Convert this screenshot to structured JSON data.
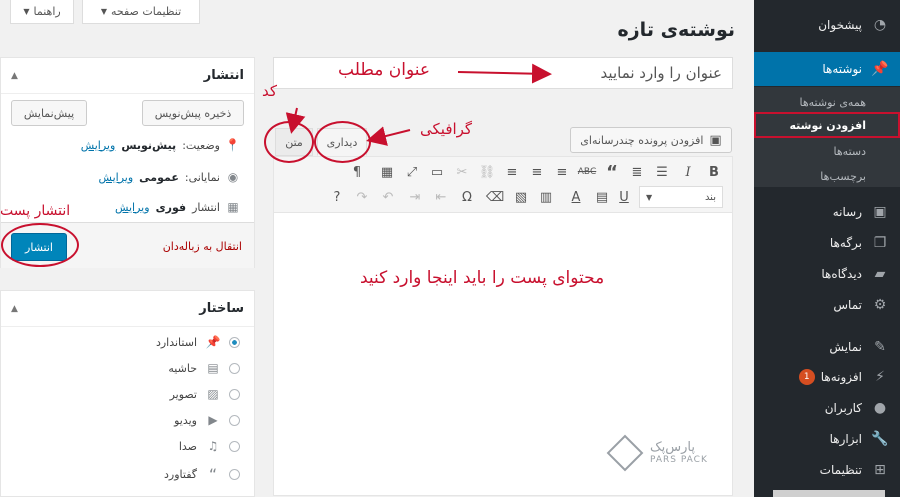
{
  "help_tabs": {
    "screen_options": "تنظیمات صفحه",
    "help": "راهنما"
  },
  "page_title": "نوشته‌ی تازه",
  "title_input": {
    "placeholder": "عنوان را وارد نمایید"
  },
  "editor": {
    "add_media": "افزودن پرونده چندرسانه‌ای",
    "tab_visual": "دیداری",
    "tab_text": "متن",
    "format_select": "بند",
    "toolbar_row1": [
      "B",
      "I",
      "bulleted-list",
      "numbered-list",
      "blockquote",
      "strikethrough",
      "align-right",
      "align-center",
      "align-left",
      "link",
      "unlink",
      "more-tag",
      "fullscreen",
      "toolbar-toggle",
      "pilcrow"
    ],
    "toolbar_row2": [
      "underline",
      "justify",
      "text-color",
      "paste-text",
      "paste-word",
      "clear-formatting",
      "special-char",
      "outdent",
      "indent",
      "undo",
      "redo",
      "help"
    ]
  },
  "publish_box": {
    "title": "انتشار",
    "save_draft": "ذخیره پیش‌نویس",
    "preview": "پیش‌نمایش",
    "status_label": "وضعیت:",
    "status_value": "پیش‌نویس",
    "visibility_label": "نمایانی:",
    "visibility_value": "عمومی",
    "schedule_label": "انتشار",
    "schedule_value": "فوری",
    "edit_link": "ویرایش",
    "trash": "انتقال به زباله‌دان",
    "publish": "انتشار"
  },
  "format_box": {
    "title": "ساختار",
    "options": [
      "استاندارد",
      "حاشیه",
      "تصویر",
      "ویدیو",
      "صدا",
      "گفتاورد"
    ],
    "selected": 0
  },
  "sidebar": {
    "dashboard": "پیشخوان",
    "posts": "نوشته‌ها",
    "submenu": [
      "همه‌ی نوشته‌ها",
      "افزودن نوشته",
      "دسته‌ها",
      "برچسب‌ها"
    ],
    "media": "رسانه",
    "pages": "برگه‌ها",
    "comments": "دیدگاه‌ها",
    "contact": "تماس",
    "appearance": "نمایش",
    "plugins": "افزونه‌ها",
    "plugins_badge": "1",
    "users": "کاربران",
    "tools": "ابزارها",
    "settings": "تنظیمات"
  },
  "annotations": {
    "post_title": "عنوان مطلب",
    "graphic": "گرافیکی",
    "code": "کد",
    "publish_post": "انتشار پست",
    "content_here": "محتوای پست را باید اینجا وارد کنید",
    "color": "#c8102e"
  },
  "watermark": {
    "name": "پارس‌پک",
    "latin": "PARS PACK"
  },
  "colors": {
    "sidebar_bg": "#23282d",
    "active_blue": "#0073aa",
    "primary_button": "#0085ba"
  }
}
